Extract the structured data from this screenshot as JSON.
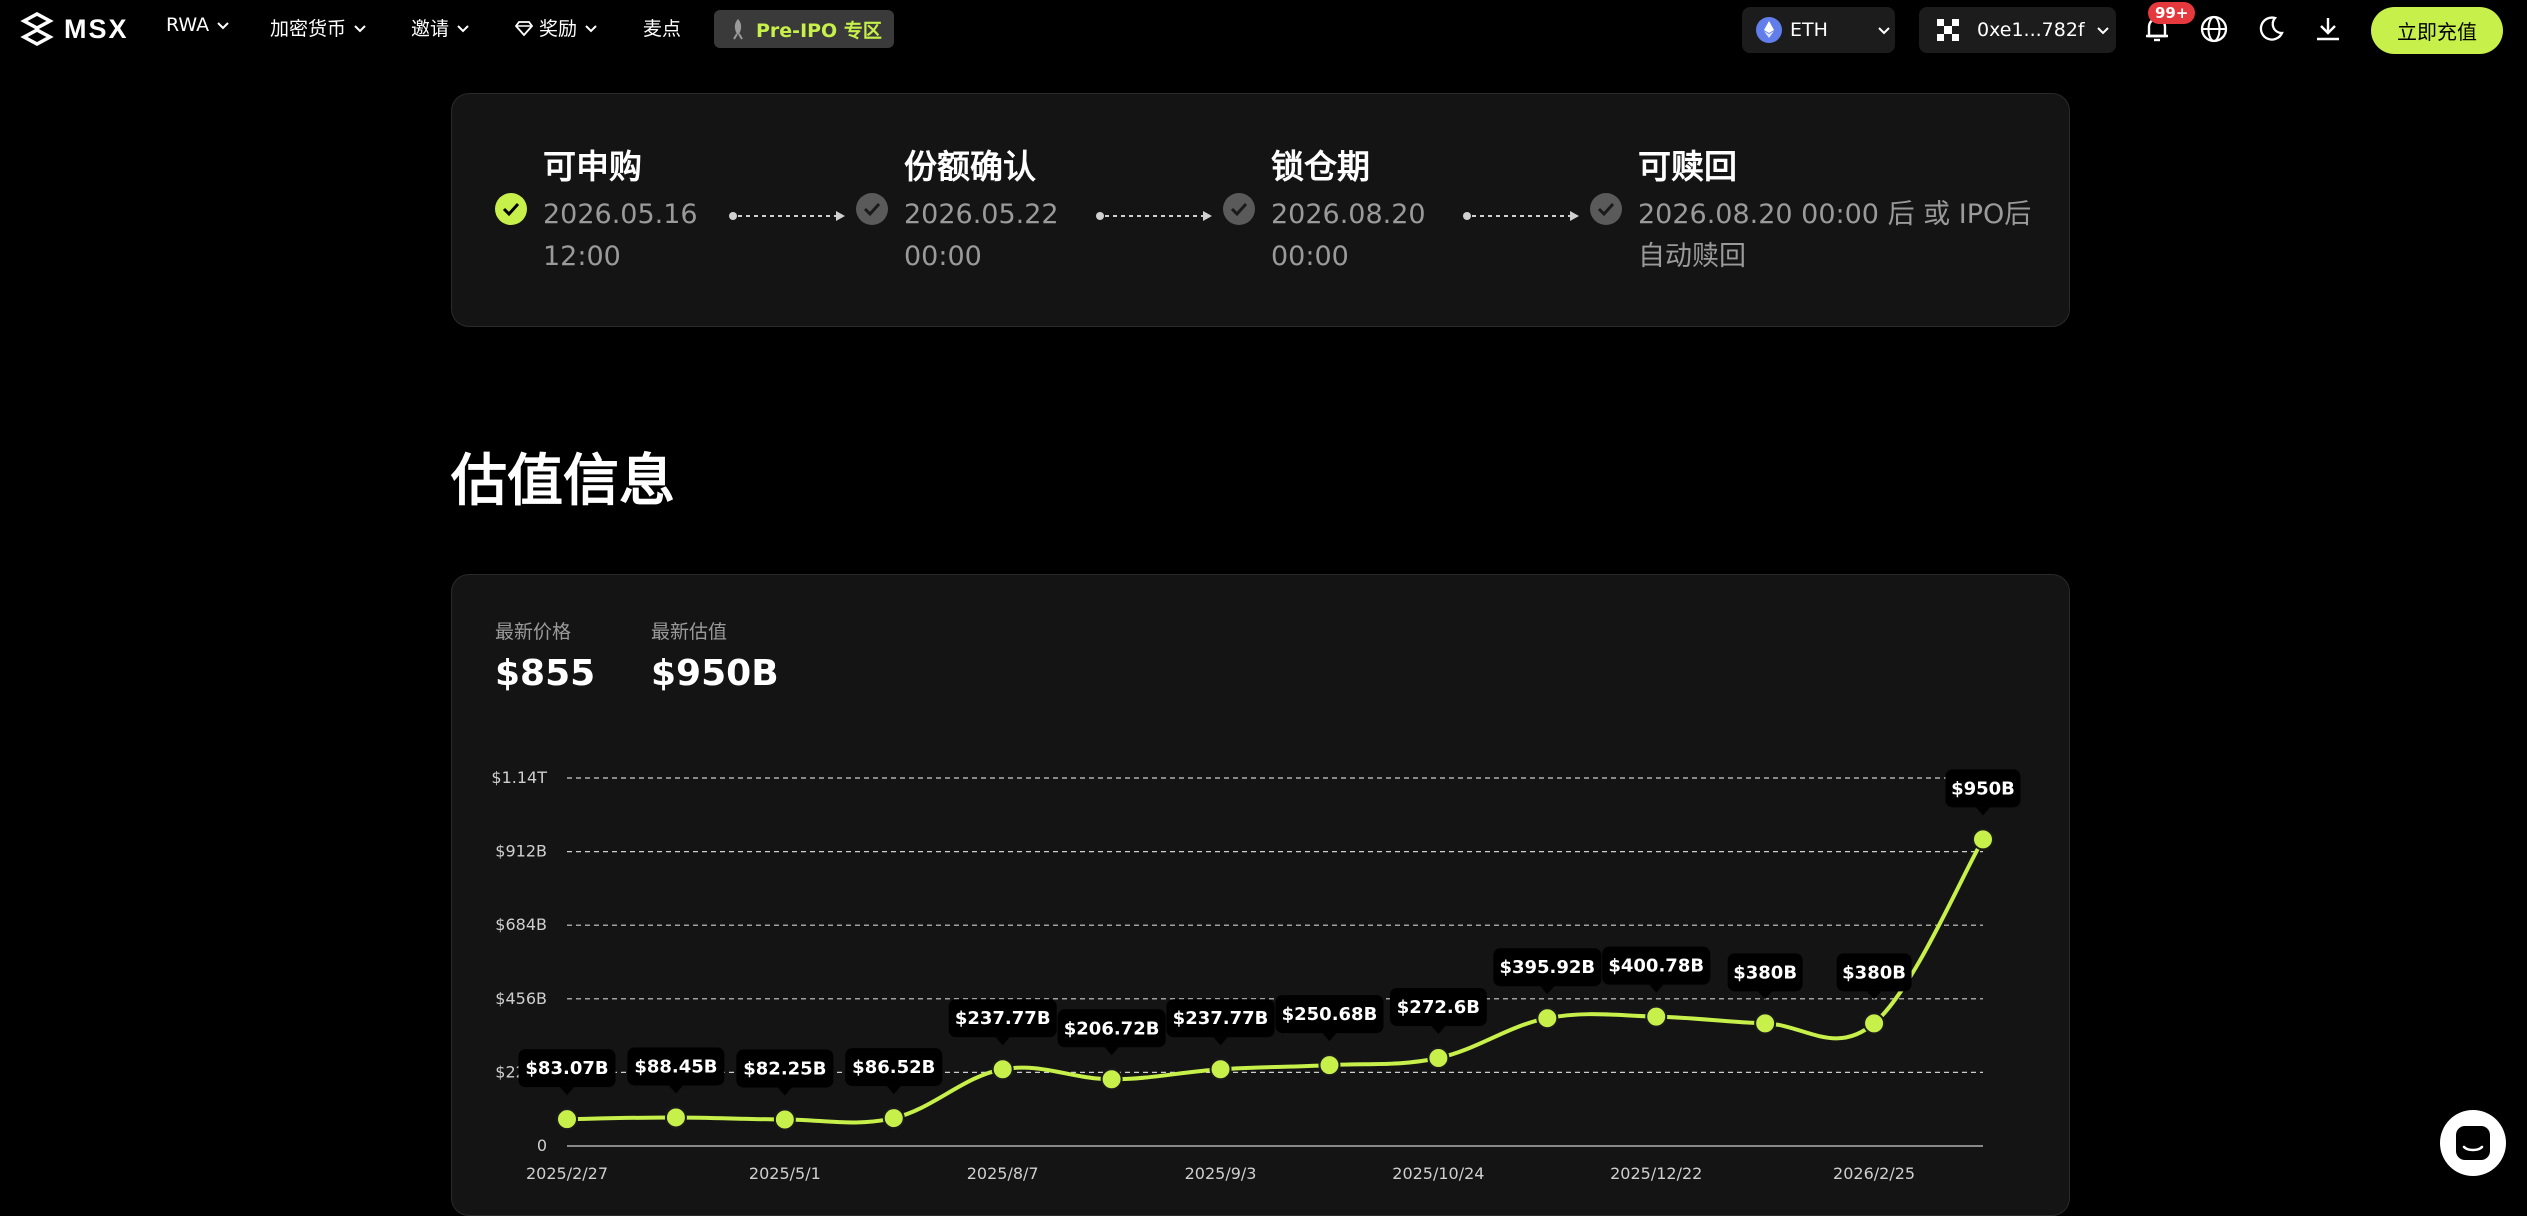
{
  "nav": {
    "logo": "MSX",
    "items": [
      {
        "label": "RWA"
      },
      {
        "label": "加密货币"
      },
      {
        "label": "邀请"
      },
      {
        "label": "奖励"
      },
      {
        "label": "麦点"
      }
    ],
    "preipo": "Pre-IPO 专区",
    "network": "ETH",
    "wallet": "0xe1...782f",
    "notif_badge": "99+",
    "deposit": "立即充值"
  },
  "timeline": [
    {
      "title": "可申购",
      "date_line1": "2026.05.16",
      "date_line2": "12:00",
      "status": "done"
    },
    {
      "title": "份额确认",
      "date_line1": "2026.05.22",
      "date_line2": "00:00",
      "status": "pending"
    },
    {
      "title": "锁仓期",
      "date_line1": "2026.08.20",
      "date_line2": "00:00",
      "status": "pending"
    },
    {
      "title": "可赎回",
      "date_line1": "2026.08.20 00:00 后 或 IPO后",
      "date_line2": "自动赎回",
      "status": "pending"
    }
  ],
  "section_title": "估值信息",
  "stats": {
    "price_label": "最新价格",
    "price_value": "$855",
    "valuation_label": "最新估值",
    "valuation_value": "$950B"
  },
  "colors": {
    "accent": "#c8f04a",
    "card_bg": "#141414",
    "muted_text": "#9a9a9a",
    "badge_red": "#e5393d"
  },
  "chart_data": {
    "type": "line",
    "title": "",
    "xlabel": "",
    "ylabel": "",
    "ylim": [
      0,
      1140
    ],
    "yticks": [
      {
        "value": 0,
        "label": "0"
      },
      {
        "value": 228,
        "label": "$228B"
      },
      {
        "value": 456,
        "label": "$456B"
      },
      {
        "value": 684,
        "label": "$684B"
      },
      {
        "value": 912,
        "label": "$912B"
      },
      {
        "value": 1140,
        "label": "$1.14T"
      }
    ],
    "xtick_labels": [
      "2025/2/27",
      "2025/5/1",
      "2025/8/7",
      "2025/9/3",
      "2025/10/24",
      "2025/12/22",
      "2026/2/25"
    ],
    "xtick_point_index": [
      0,
      2,
      4,
      6,
      8,
      10,
      12
    ],
    "grid": "dashed-horizontal",
    "series": [
      {
        "values": [
          83.07,
          88.45,
          82.25,
          86.52,
          237.77,
          206.72,
          237.77,
          250.68,
          272.6,
          395.92,
          400.78,
          380,
          380,
          950
        ],
        "labels": [
          "$83.07B",
          "$88.45B",
          "$82.25B",
          "$86.52B",
          "$237.77B",
          "$206.72B",
          "$237.77B",
          "$250.68B",
          "$272.6B",
          "$395.92B",
          "$400.78B",
          "$380B",
          "$380B",
          "$950B"
        ]
      }
    ]
  }
}
